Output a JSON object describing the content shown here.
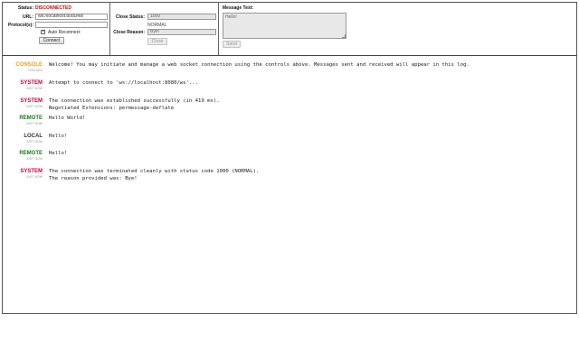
{
  "connection": {
    "status_label": "Status:",
    "status_value": "DISCONNECTED",
    "url_label": "URL:",
    "url_value": "ws://localhost:8080/ws",
    "protocols_label": "Protocol(s):",
    "protocols_value": "",
    "auto_reconnect_label": "Auto Reconnect",
    "auto_reconnect_checked": true,
    "connect_label": "Connect"
  },
  "close_panel": {
    "close_status_label": "Close Status:",
    "close_status_value": "1000",
    "close_status_name": "NORMAL",
    "close_reason_label": "Close Reason:",
    "close_reason_value": "Bye!",
    "close_button_label": "Close"
  },
  "message_panel": {
    "title": "Message Text:",
    "text_value": "Hello!",
    "send_label": "Send"
  },
  "log": {
    "entries": [
      {
        "source": "CONSOLE",
        "source_color": "#f0a020",
        "time": "THIS ADD",
        "lines": [
          "Welcome! You may initiate and manage a web socket connection using the controls above. Messages sent and received will appear in this log."
        ]
      },
      {
        "source": "SYSTEM",
        "source_color": "#cc0033",
        "time": "JUST NOW",
        "lines": [
          "Attempt to connect to 'ws://localhost:8080/ws'..."
        ]
      },
      {
        "source": "SYSTEM",
        "source_color": "#cc0033",
        "time": "JUST NOW",
        "lines": [
          "The connection was established successfully (in 419 ms).",
          "Negotiated Extensions: permessage-deflate"
        ]
      },
      {
        "source": "REMOTE",
        "source_color": "#1a7a1a",
        "time": "JUST NOW",
        "lines": [
          "Hello World!"
        ]
      },
      {
        "source": "LOCAL",
        "source_color": "#333333",
        "time": "JUST NOW",
        "lines": [
          "Hello!"
        ]
      },
      {
        "source": "REMOTE",
        "source_color": "#1a7a1a",
        "time": "JUST NOW",
        "lines": [
          "Hello!"
        ]
      },
      {
        "source": "SYSTEM",
        "source_color": "#cc0033",
        "time": "JUST NOW",
        "lines": [
          "The connection was terminated cleanly with status code 1000 (NORMAL).",
          "The reason provided was: Bye!"
        ]
      }
    ]
  }
}
